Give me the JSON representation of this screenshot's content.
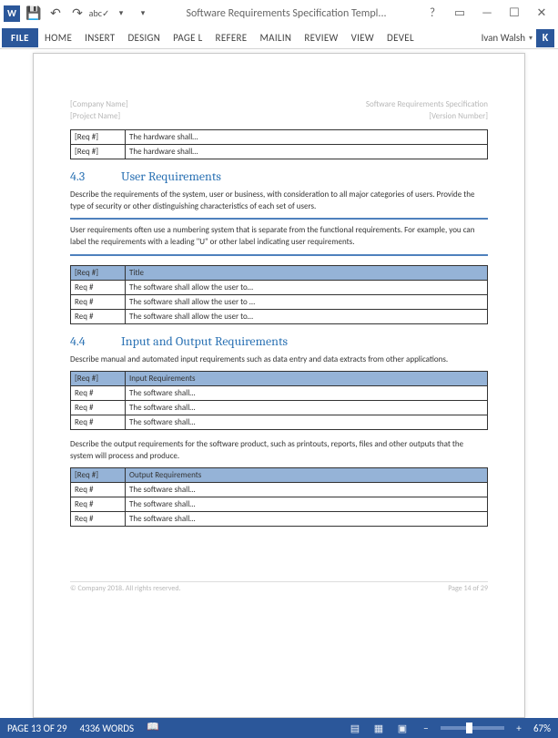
{
  "titlebar": {
    "title": "Software Requirements Specification Templ..."
  },
  "ribbon": {
    "file": "FILE",
    "tabs": [
      "HOME",
      "INSERT",
      "DESIGN",
      "PAGE L",
      "REFERE",
      "MAILIN",
      "REVIEW",
      "VIEW",
      "DEVEL"
    ],
    "user": "Ivan Walsh",
    "user_initial": "K"
  },
  "document": {
    "header": {
      "left_top": "[Company Name]",
      "left_bottom": "[Project Name]",
      "right_top": "Software Requirements Specification",
      "right_bottom": "[Version Number]"
    },
    "hardware_table": {
      "rows": [
        {
          "req": "[Req #]",
          "text": "The hardware shall…"
        },
        {
          "req": "[Req #]",
          "text": "The hardware shall…"
        }
      ]
    },
    "section_4_3": {
      "num": "4.3",
      "title": "User Requirements",
      "intro": "Describe the requirements of the system, user or business, with consideration to all major categories of users. Provide the type of security or other distinguishing characteristics of each set of users.",
      "note": "User requirements often use a numbering system that is separate from the functional requirements. For example, you can label the requirements with a leading \"U\" or other label indicating user requirements.",
      "table": {
        "head_req": "[Req #]",
        "head_title": "Title",
        "rows": [
          {
            "req": "Req #",
            "text": "The software shall allow the user to…"
          },
          {
            "req": "Req #",
            "text": "The software shall allow the user to …"
          },
          {
            "req": "Req #",
            "text": "The software shall allow the user to…"
          }
        ]
      }
    },
    "section_4_4": {
      "num": "4.4",
      "title": "Input and Output Requirements",
      "intro": "Describe manual and automated input requirements such as data entry and data extracts from other applications.",
      "input_table": {
        "head_req": "[Req #]",
        "head_title": "Input Requirements",
        "rows": [
          {
            "req": "Req #",
            "text": "The software shall…"
          },
          {
            "req": "Req #",
            "text": "The software shall…"
          },
          {
            "req": "Req #",
            "text": "The software shall…"
          }
        ]
      },
      "middle_text": "Describe the output requirements for the software product, such as printouts, reports, files and other outputs that the system will process and produce.",
      "output_table": {
        "head_req": "[Req #]",
        "head_title": "Output Requirements",
        "rows": [
          {
            "req": "Req #",
            "text": "The software shall…"
          },
          {
            "req": "Req #",
            "text": "The software shall…"
          },
          {
            "req": "Req #",
            "text": "The software shall…"
          }
        ]
      }
    },
    "footer": {
      "left": "© Company 2018. All rights reserved.",
      "right": "Page 14 of 29"
    }
  },
  "statusbar": {
    "page": "PAGE 13 OF 29",
    "words": "4336 WORDS",
    "zoom": "67%"
  }
}
